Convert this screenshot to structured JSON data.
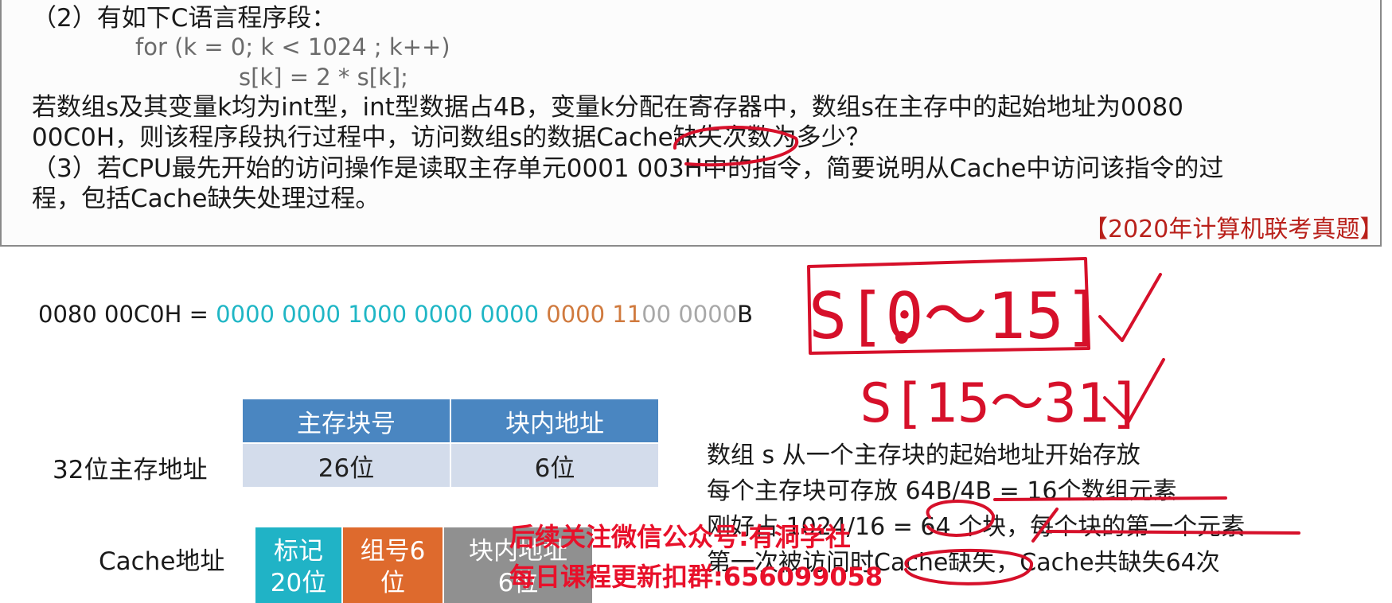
{
  "question": {
    "part2_title": "（2）有如下C语言程序段：",
    "code_line1": "for (k = 0; k < 1024 ; k++)",
    "code_line2": "s[k] = 2 * s[k];",
    "part2_line1": "若数组s及其变量k均为int型，int型数据占4B，变量k分配在寄存器中，数组s在主存中的起始地址为0080",
    "part2_line2": "00C0H，则该程序段执行过程中，访问数组s的数据Cache缺失次数为多少？",
    "part3_line1": "（3）若CPU最先开始的访问操作是读取主存单元0001 003H中的指令，简要说明从Cache中访问该指令的过",
    "part3_line2": "程，包括Cache缺失处理过程。",
    "source": "【2020年计算机联考真题】"
  },
  "address": {
    "lhs": "0080 00C0H = ",
    "seg_teal": "0000 0000 1000 0000 0000 ",
    "seg_orange": "0000 11",
    "seg_gray": "00 0000",
    "suffix": "B"
  },
  "main_memory": {
    "label": "32位主存地址",
    "headers": [
      "主存块号",
      "块内地址"
    ],
    "values": [
      "26位",
      "6位"
    ]
  },
  "cache": {
    "label": "Cache地址",
    "tag_line1": "标记",
    "tag_line2": "20位",
    "set_line1": "组号6",
    "set_line2": "位",
    "offset_line1": "块内地址",
    "offset_line2": "6位"
  },
  "notes": [
    "数组 s 从一个主存块的起始地址开始存放",
    "每个主存块可存放 64B/4B = 16个数组元素",
    "刚好占 1024/16 = 64 个块，每个块的第一个元素",
    "第一次被访问时Cache缺失，Cache共缺失64次"
  ],
  "handwriting": {
    "line1": "S[0～15]",
    "line2": "S[15～31]"
  },
  "watermark": {
    "line1": "后续关注微信公众号:有洞学社",
    "line2": "每日课程更新扣群:656099058"
  },
  "colors": {
    "accent_teal": "#1fb6c5",
    "accent_orange": "#d07a3e",
    "header_blue": "#4a86c1",
    "cell_light": "#d3dceb",
    "source_red": "#b9211b",
    "ink_red": "#d6102a"
  }
}
